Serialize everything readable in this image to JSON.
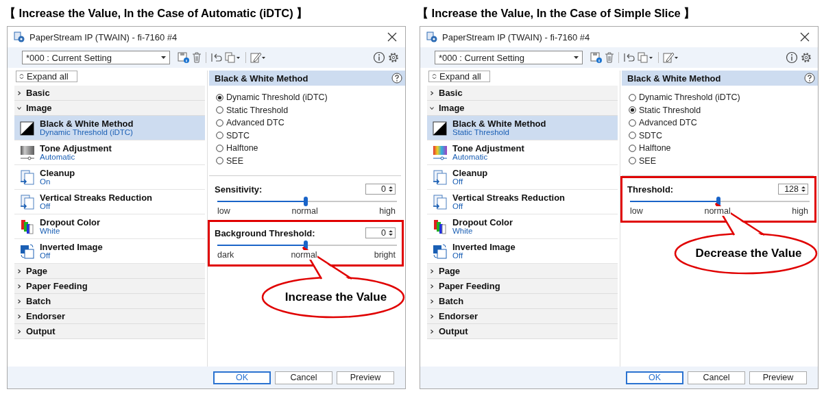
{
  "panels": [
    {
      "heading": "【 Increase the Value, In the Case of Automatic (iDTC) 】",
      "dialog": {
        "title": "PaperStream IP (TWAIN) - fi-7160 #4",
        "profile": "*000 : Current Setting",
        "expand_all": "Expand all",
        "tree": [
          {
            "label": "Basic",
            "expanded": false
          },
          {
            "label": "Image",
            "expanded": true,
            "children": [
              {
                "title": "Black & White Method",
                "value": "Dynamic Threshold (iDTC)",
                "selected": true,
                "grayed_icon": false
              },
              {
                "title": "Tone Adjustment",
                "value": "Automatic",
                "selected": false,
                "grayed_icon": true
              },
              {
                "title": "Cleanup",
                "value": "On",
                "selected": false,
                "grayed_icon": false
              },
              {
                "title": "Vertical Streaks Reduction",
                "value": "Off",
                "selected": false,
                "grayed_icon": false
              },
              {
                "title": "Dropout Color",
                "value": "White",
                "selected": false,
                "grayed_icon": false
              },
              {
                "title": "Inverted Image",
                "value": "Off",
                "selected": false,
                "grayed_icon": false
              }
            ]
          },
          {
            "label": "Page",
            "expanded": false
          },
          {
            "label": "Paper Feeding",
            "expanded": false
          },
          {
            "label": "Batch",
            "expanded": false
          },
          {
            "label": "Endorser",
            "expanded": false
          },
          {
            "label": "Output",
            "expanded": false
          }
        ],
        "detail": {
          "title": "Black & White Method",
          "options": [
            {
              "label": "Dynamic Threshold (iDTC)",
              "selected": true
            },
            {
              "label": "Static Threshold",
              "selected": false
            },
            {
              "label": "Advanced DTC",
              "selected": false
            },
            {
              "label": "SDTC",
              "selected": false
            },
            {
              "label": "Halftone",
              "selected": false
            },
            {
              "label": "SEE",
              "selected": false
            }
          ],
          "sliders": [
            {
              "label": "Sensitivity:",
              "value": "0",
              "level": 0.5,
              "ticks": [
                "low",
                "normal",
                "high"
              ],
              "highlighted": false
            },
            {
              "label": "Background Threshold:",
              "value": "0",
              "level": 0.5,
              "ticks": [
                "dark",
                "normal",
                "bright"
              ],
              "highlighted": true,
              "callout": "Increase the Value"
            }
          ]
        },
        "buttons": [
          {
            "label": "OK",
            "default": true
          },
          {
            "label": "Cancel",
            "default": false
          },
          {
            "label": "Preview",
            "default": false
          }
        ]
      }
    },
    {
      "heading": "【 Increase the Value, In the Case of Simple Slice 】",
      "dialog": {
        "title": "PaperStream IP (TWAIN) - fi-7160 #4",
        "profile": "*000 : Current Setting",
        "expand_all": "Expand all",
        "tree": [
          {
            "label": "Basic",
            "expanded": false
          },
          {
            "label": "Image",
            "expanded": true,
            "children": [
              {
                "title": "Black & White Method",
                "value": "Static Threshold",
                "selected": true,
                "grayed_icon": false
              },
              {
                "title": "Tone Adjustment",
                "value": "Automatic",
                "selected": false,
                "grayed_icon": false
              },
              {
                "title": "Cleanup",
                "value": "Off",
                "selected": false,
                "grayed_icon": false
              },
              {
                "title": "Vertical Streaks Reduction",
                "value": "Off",
                "selected": false,
                "grayed_icon": false
              },
              {
                "title": "Dropout Color",
                "value": "White",
                "selected": false,
                "grayed_icon": false
              },
              {
                "title": "Inverted Image",
                "value": "Off",
                "selected": false,
                "grayed_icon": false
              }
            ]
          },
          {
            "label": "Page",
            "expanded": false
          },
          {
            "label": "Paper Feeding",
            "expanded": false
          },
          {
            "label": "Batch",
            "expanded": false
          },
          {
            "label": "Endorser",
            "expanded": false
          },
          {
            "label": "Output",
            "expanded": false
          }
        ],
        "detail": {
          "title": "Black & White Method",
          "options": [
            {
              "label": "Dynamic Threshold (iDTC)",
              "selected": false
            },
            {
              "label": "Static Threshold",
              "selected": true
            },
            {
              "label": "Advanced DTC",
              "selected": false
            },
            {
              "label": "SDTC",
              "selected": false
            },
            {
              "label": "Halftone",
              "selected": false
            },
            {
              "label": "SEE",
              "selected": false
            }
          ],
          "sliders": [
            {
              "label": "Threshold:",
              "value": "128",
              "level": 0.5,
              "ticks": [
                "low",
                "normal",
                "high"
              ],
              "highlighted": true,
              "callout": "Decrease the Value"
            }
          ]
        },
        "buttons": [
          {
            "label": "OK",
            "default": true
          },
          {
            "label": "Cancel",
            "default": false
          },
          {
            "label": "Preview",
            "default": false
          }
        ]
      }
    }
  ]
}
